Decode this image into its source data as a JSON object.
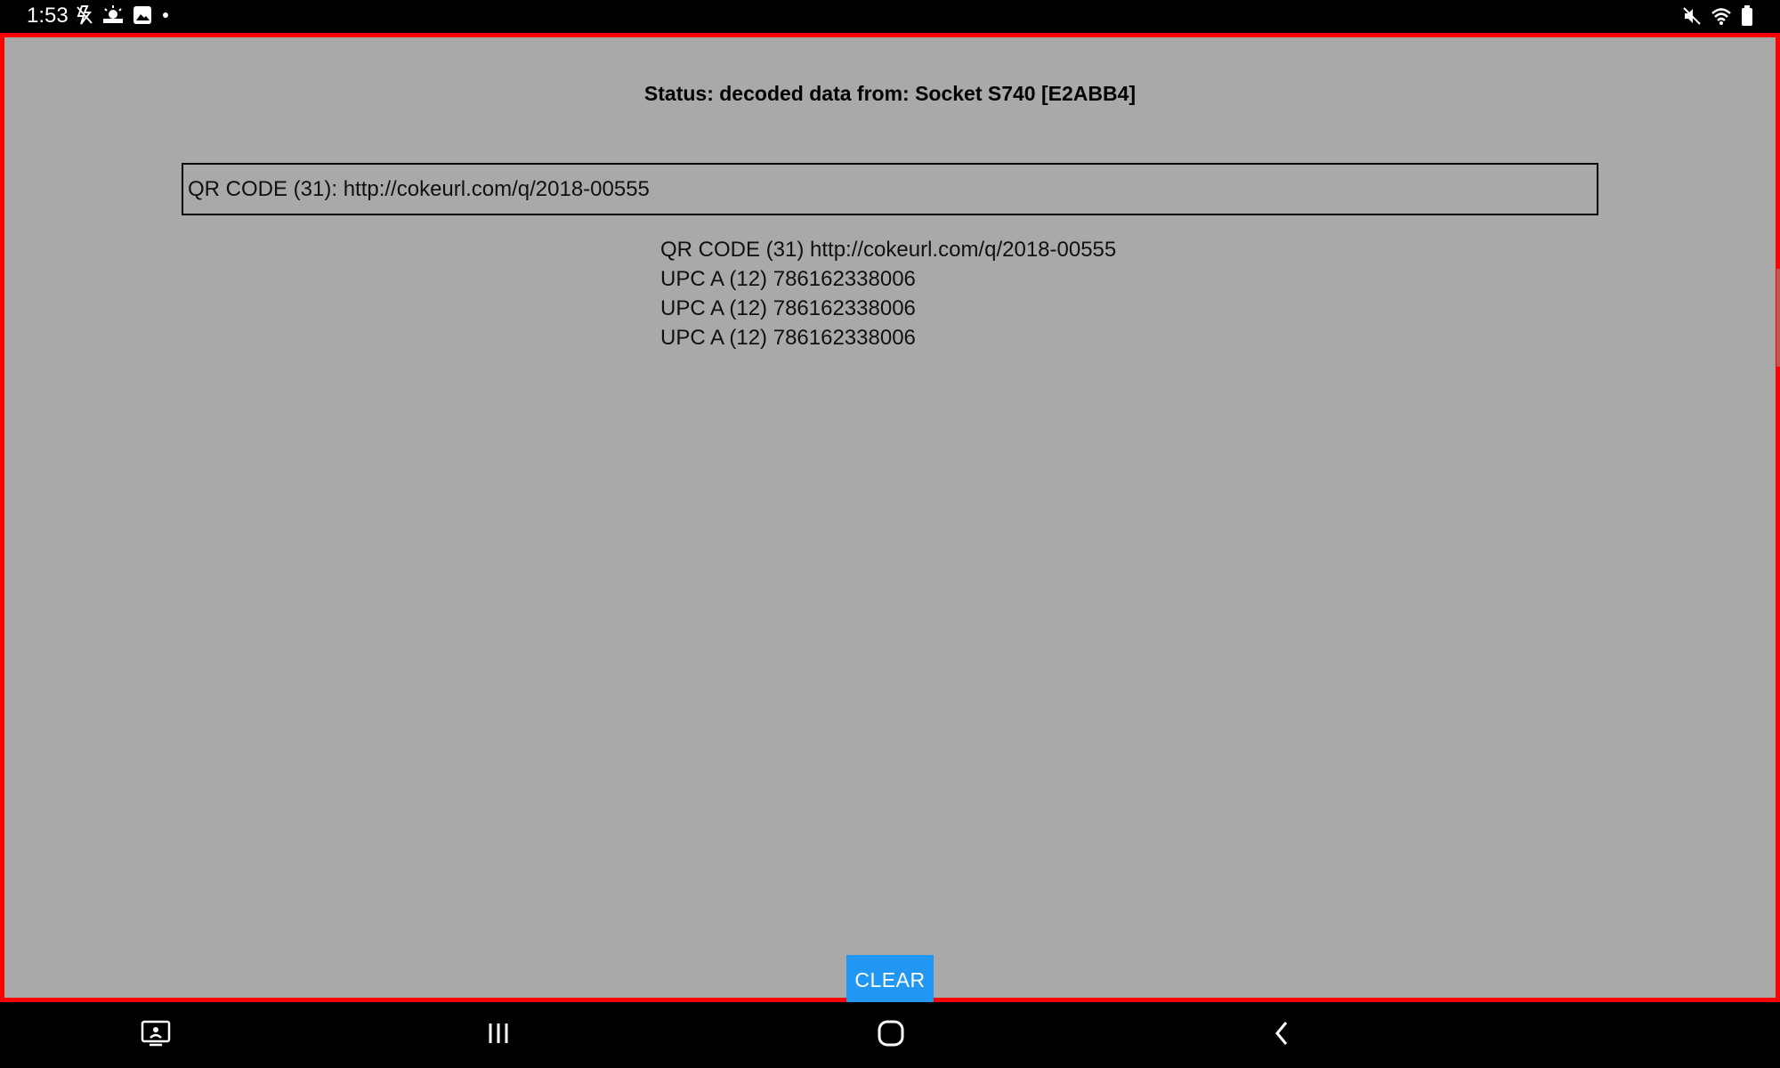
{
  "status_bar": {
    "time": "1:53",
    "left_icons": [
      "flash-off-icon",
      "weather-icon",
      "gallery-icon",
      "dot-icon"
    ],
    "right_icons": [
      "mute-icon",
      "wifi-icon",
      "battery-icon"
    ]
  },
  "app": {
    "status_text": "Status: decoded data from: Socket S740 [E2ABB4]",
    "input_value": "QR CODE (31): http://cokeurl.com/q/2018-00555",
    "scans": [
      "QR CODE (31) http://cokeurl.com/q/2018-00555",
      "UPC A (12) 786162338006",
      "UPC A (12) 786162338006",
      "UPC A (12) 786162338006"
    ],
    "clear_label": "CLEAR",
    "accent_color": "#2196f3",
    "background_color": "#a9a9a9",
    "border_color": "#ff0000"
  },
  "nav_bar": {
    "buttons": [
      "screen-capture-icon",
      "recents-icon",
      "home-icon",
      "back-icon"
    ]
  }
}
